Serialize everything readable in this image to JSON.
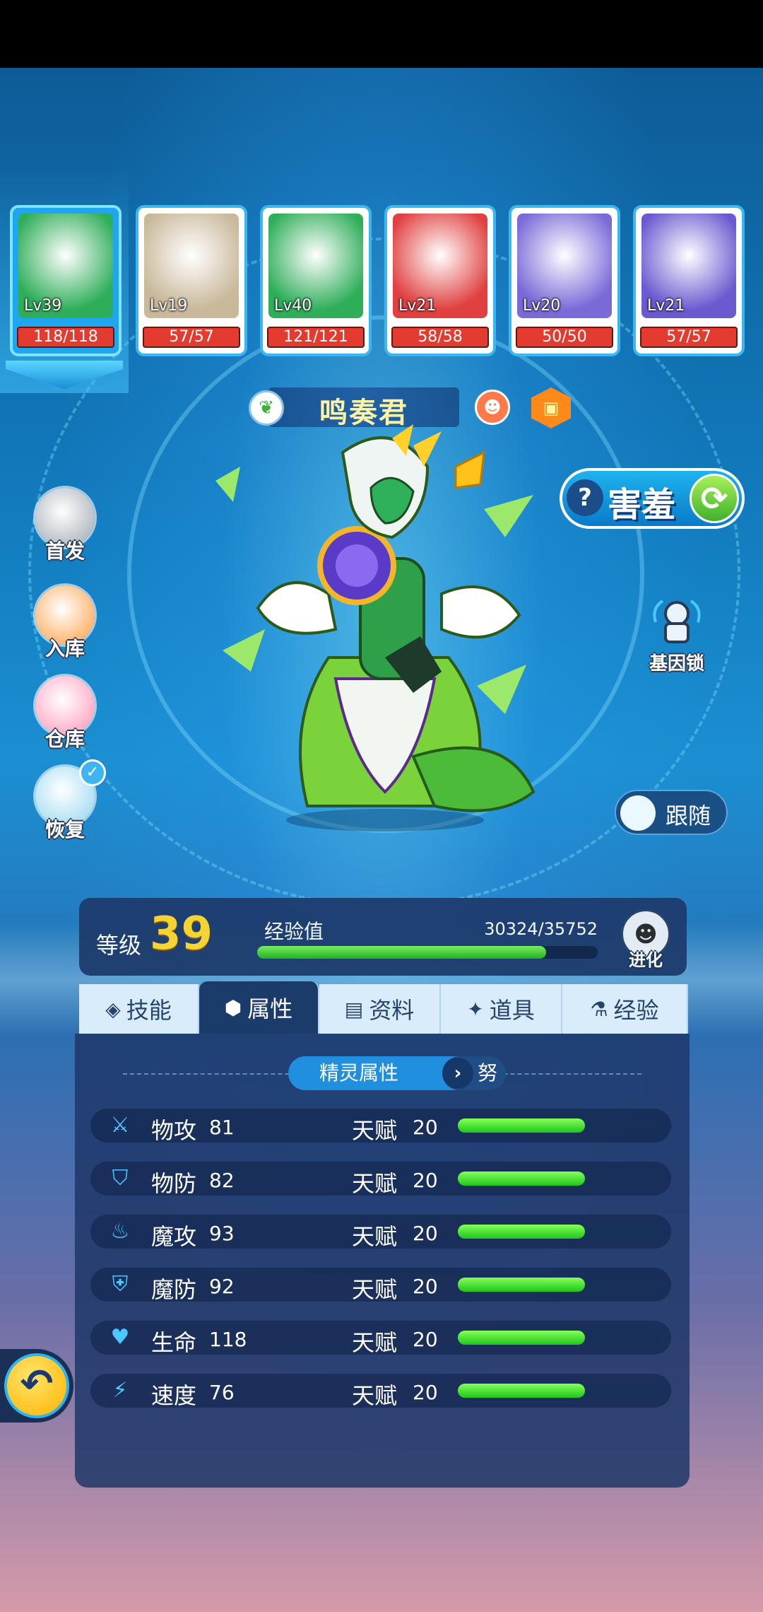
{
  "team": [
    {
      "level": "Lv39",
      "hp": "118/118",
      "active": true,
      "tint": "#2fae5a"
    },
    {
      "level": "Lv19",
      "hp": "57/57",
      "active": false,
      "tint": "#c9b89a"
    },
    {
      "level": "Lv40",
      "hp": "121/121",
      "active": false,
      "tint": "#2fae5a"
    },
    {
      "level": "Lv21",
      "hp": "58/58",
      "active": false,
      "tint": "#e04040"
    },
    {
      "level": "Lv20",
      "hp": "50/50",
      "active": false,
      "tint": "#7a6ad8"
    },
    {
      "level": "Lv21",
      "hp": "57/57",
      "active": false,
      "tint": "#6a5ad0"
    }
  ],
  "pet": {
    "name": "鸣奏君",
    "element_icon": "grass-icon",
    "trait": "害羞",
    "follow_label": "跟随"
  },
  "side_menu": [
    {
      "label": "首发",
      "icon": "cat-icon"
    },
    {
      "label": "入库",
      "icon": "storage-icon"
    },
    {
      "label": "仓库",
      "icon": "warehouse-icon"
    },
    {
      "label": "恢复",
      "icon": "heal-potion-icon"
    }
  ],
  "gene_lock_label": "基因锁",
  "level": {
    "label": "等级",
    "value": "39",
    "exp_label": "经验值",
    "exp_text": "30324/35752",
    "exp_current": 30324,
    "exp_max": 35752,
    "evolve_label": "进化"
  },
  "tabs": [
    {
      "label": "技能",
      "icon": "skill-icon",
      "active": false
    },
    {
      "label": "属性",
      "icon": "attribute-icon",
      "active": true
    },
    {
      "label": "资料",
      "icon": "document-icon",
      "active": false
    },
    {
      "label": "道具",
      "icon": "item-icon",
      "active": false
    },
    {
      "label": "经验",
      "icon": "flask-icon",
      "active": false
    }
  ],
  "panel": {
    "title": "精灵属性",
    "nature": "努",
    "talent_label": "天赋"
  },
  "stats": [
    {
      "name": "物攻",
      "value": "81",
      "talent": "20",
      "talent_fill": 0.62,
      "icon": "sword-icon"
    },
    {
      "name": "物防",
      "value": "82",
      "talent": "20",
      "talent_fill": 0.62,
      "icon": "shield-icon"
    },
    {
      "name": "魔攻",
      "value": "93",
      "talent": "20",
      "talent_fill": 0.62,
      "icon": "flame-icon"
    },
    {
      "name": "魔防",
      "value": "92",
      "talent": "20",
      "talent_fill": 0.62,
      "icon": "magic-shield-icon"
    },
    {
      "name": "生命",
      "value": "118",
      "talent": "20",
      "talent_fill": 0.62,
      "icon": "heart-icon"
    },
    {
      "name": "速度",
      "value": "76",
      "talent": "20",
      "talent_fill": 0.62,
      "icon": "boot-icon"
    }
  ]
}
